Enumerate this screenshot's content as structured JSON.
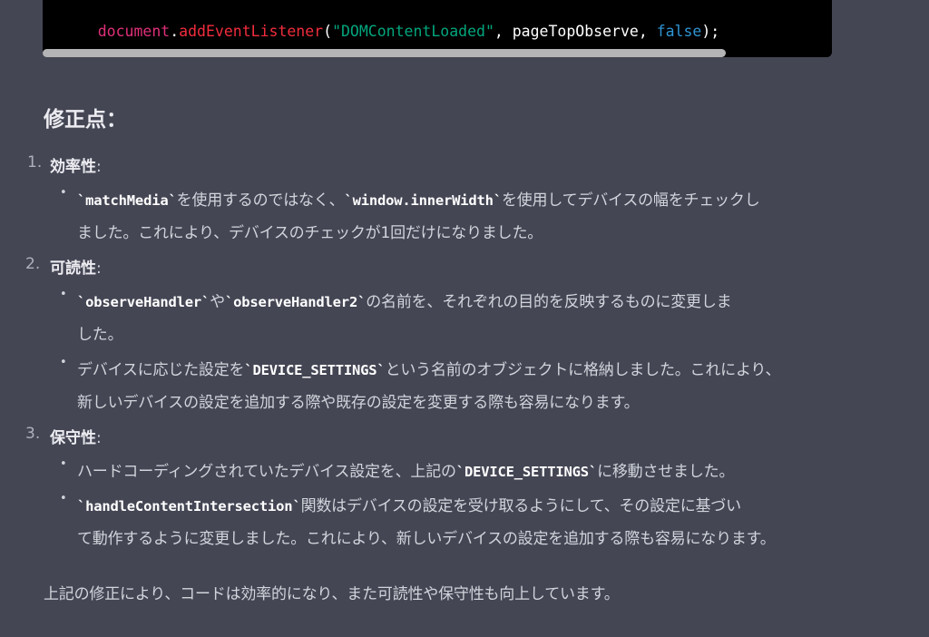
{
  "code": {
    "tokens": [
      {
        "text": "document",
        "cls": "tok-obj"
      },
      {
        "text": ".",
        "cls": "tok-plain"
      },
      {
        "text": "addEventListener",
        "cls": "tok-fn"
      },
      {
        "text": "(",
        "cls": "tok-plain"
      },
      {
        "text": "\"DOMContentLoaded\"",
        "cls": "tok-str"
      },
      {
        "text": ", pageTopObserve, ",
        "cls": "tok-plain"
      },
      {
        "text": "false",
        "cls": "tok-bool"
      },
      {
        "text": ");",
        "cls": "tok-plain"
      }
    ]
  },
  "heading": "修正点：",
  "sections": [
    {
      "num": "1.",
      "title": "効率性",
      "colon": ":",
      "b1": {
        "l1_code1": "matchMedia",
        "l1_t1": "を使用するのではなく、",
        "l1_code2": "window.innerWidth",
        "l1_t2": "を使用してデバイスの幅をチェックし",
        "l2": "ました。これにより、デバイスのチェックが1回だけになりました。"
      }
    },
    {
      "num": "2.",
      "title": "可読性",
      "colon": ":",
      "b1": {
        "l1_code1": "observeHandler",
        "l1_t1": "や",
        "l1_code2": "observeHandler2",
        "l1_t2": "の名前を、それぞれの目的を反映するものに変更しま",
        "l2": "した。"
      },
      "b2": {
        "l1_t1": "デバイスに応じた設定を",
        "l1_code1": "DEVICE_SETTINGS",
        "l1_t2": "という名前のオブジェクトに格納しました。これにより、",
        "l2": "新しいデバイスの設定を追加する際や既存の設定を変更する際も容易になります。"
      }
    },
    {
      "num": "3.",
      "title": "保守性",
      "colon": ":",
      "b1": {
        "l1_t1": "ハードコーディングされていたデバイス設定を、上記の",
        "l1_code1": "DEVICE_SETTINGS",
        "l1_t2": "に移動させました。"
      },
      "b2": {
        "l1_code1": "handleContentIntersection",
        "l1_t1": "関数はデバイスの設定を受け取るようにして、その設定に基づい",
        "l2": "て動作するように変更しました。これにより、新しいデバイスの設定を追加する際も容易になります。"
      }
    }
  ],
  "footer": "上記の修正により、コードは効率的になり、また可読性や保守性も向上しています。",
  "ui": {
    "bullet": "•",
    "backtick": "`"
  }
}
